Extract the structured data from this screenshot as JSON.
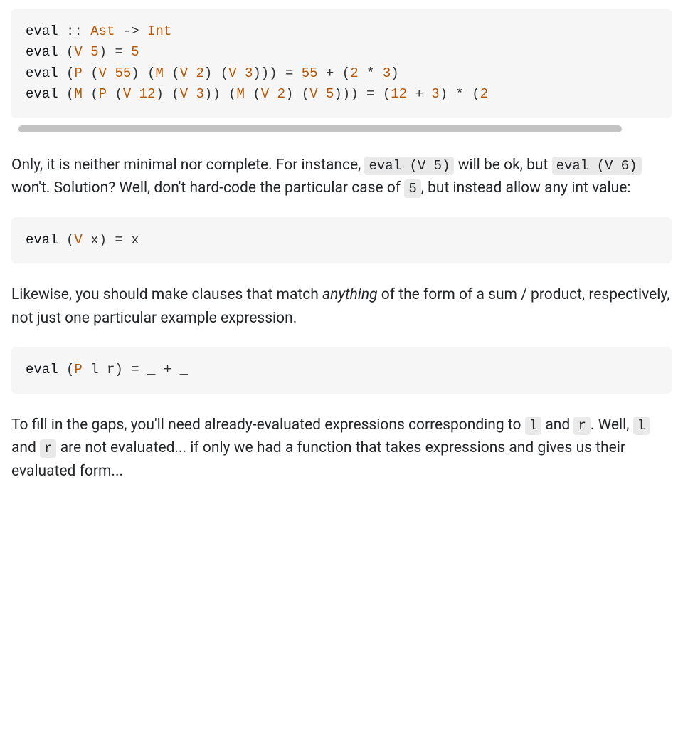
{
  "code1": {
    "line1": {
      "kw": "eval",
      "p1": " :: ",
      "t1": "Ast",
      "p2": " -> ",
      "t2": "Int"
    },
    "line2": {
      "kw": "eval",
      "p1": " (",
      "c1": "V",
      "p2": " ",
      "n1": "5",
      "p3": ") = ",
      "n2": "5"
    },
    "line3": {
      "kw": "eval",
      "p1": " (",
      "c1": "P",
      "p2": " (",
      "c2": "V",
      "p3": " ",
      "n1": "55",
      "p4": ") (",
      "c3": "M",
      "p5": " (",
      "c4": "V",
      "p6": " ",
      "n2": "2",
      "p7": ") (",
      "c5": "V",
      "p8": " ",
      "n3": "3",
      "p9": "))) = ",
      "n4": "55",
      "p10": " + (",
      "n5": "2",
      "p11": " * ",
      "n6": "3",
      "p12": ")"
    },
    "line4": {
      "kw": "eval",
      "p1": " (",
      "c1": "M",
      "p2": " (",
      "c2": "P",
      "p3": " (",
      "c3": "V",
      "p4": " ",
      "n1": "12",
      "p5": ") (",
      "c4": "V",
      "p6": " ",
      "n2": "3",
      "p7": ")) (",
      "c5": "M",
      "p8": " (",
      "c6": "V",
      "p9": " ",
      "n3": "2",
      "p10": ") (",
      "c7": "V",
      "p11": " ",
      "n4": "5",
      "p12": "))) = (",
      "n5": "12",
      "p13": " + ",
      "n6": "3",
      "p14": ") * (",
      "n7": "2"
    }
  },
  "para1": {
    "t1": "Only, it is neither minimal nor complete. For instance, ",
    "c1": "eval (V 5)",
    "t2": " will be ok, but ",
    "c2": "eval (V 6)",
    "t3": " won't. Solution? Well, don't hard-code the particular case of ",
    "c3": "5",
    "t4": ", but instead allow any int value:"
  },
  "code2": {
    "kw": "eval",
    "p1": " (",
    "c1": "V",
    "p2": " x) = x"
  },
  "para2": {
    "t1": "Likewise, you should make clauses that match ",
    "em": "anything",
    "t2": " of the form of a sum / product, respectively, not just one particular example expression."
  },
  "code3": {
    "kw": "eval",
    "p1": " (",
    "c1": "P",
    "p2": " l r) = _ + _"
  },
  "para3": {
    "t1": "To fill in the gaps, you'll need already-evaluated expressions corresponding to ",
    "c1": "l",
    "t2": " and ",
    "c2": "r",
    "t3": ". Well, ",
    "c3": "l",
    "t4": " and ",
    "c4": "r",
    "t5": " are not evaluated... if only we had a function that takes expressions and gives us their evaluated form..."
  }
}
